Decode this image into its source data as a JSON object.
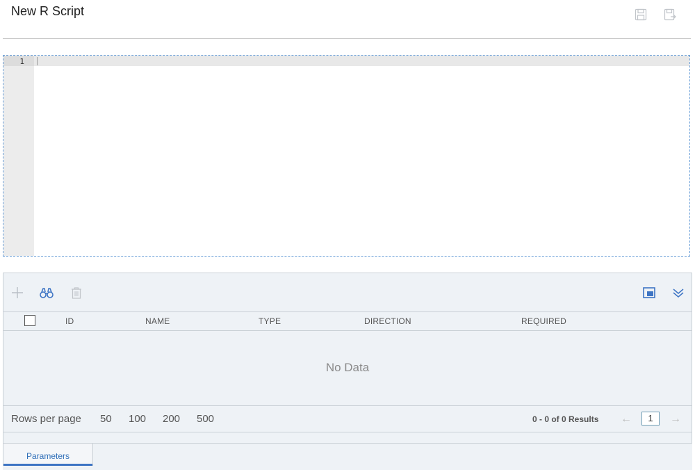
{
  "header": {
    "title": "New R Script",
    "actions": [
      {
        "icon": "save-icon"
      },
      {
        "icon": "save-as-icon"
      }
    ]
  },
  "editor": {
    "line_numbers": [
      "1"
    ]
  },
  "grid": {
    "toolbar": {
      "left": [
        "add-icon",
        "binoculars-icon",
        "trash-icon"
      ],
      "right": [
        "window-icon",
        "double-chevron-down-icon"
      ]
    },
    "columns": [
      "ID",
      "NAME",
      "TYPE",
      "DIRECTION",
      "REQUIRED"
    ],
    "empty_text": "No Data",
    "footer": {
      "rows_per_page_label": "Rows per page",
      "page_sizes": [
        "50",
        "100",
        "200",
        "500"
      ],
      "results": "0 - 0 of 0 Results",
      "current_page": "1",
      "prev_arrow": "←",
      "next_arrow": "→"
    }
  },
  "tabs": [
    {
      "label": "Parameters",
      "active": true
    }
  ],
  "colors": {
    "accent": "#3d74c4",
    "panel_bg": "#eef2f6",
    "icon_muted": "#b8bec6"
  }
}
